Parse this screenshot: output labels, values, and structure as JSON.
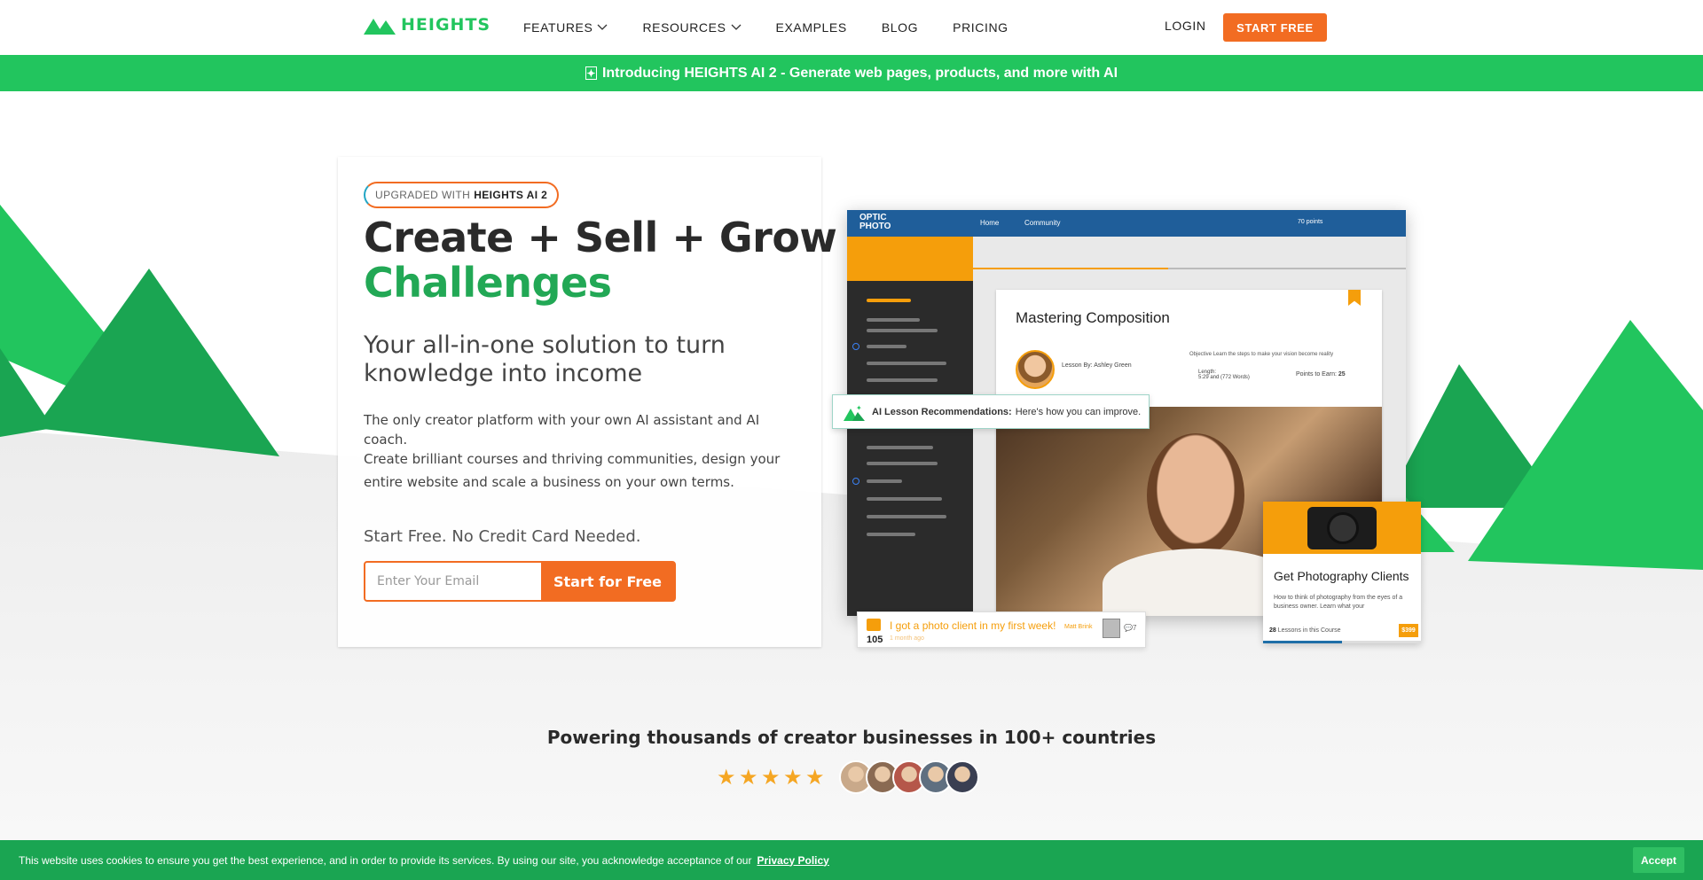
{
  "nav": {
    "logo_text": "HEIGHTS",
    "menu": [
      {
        "label": "FEATURES",
        "has_dropdown": true
      },
      {
        "label": "RESOURCES",
        "has_dropdown": true
      },
      {
        "label": "EXAMPLES",
        "has_dropdown": false
      },
      {
        "label": "BLOG",
        "has_dropdown": false
      },
      {
        "label": "PRICING",
        "has_dropdown": false
      }
    ],
    "login_label": "LOGIN",
    "start_label": "START FREE"
  },
  "announcement": {
    "icon": "sparkle-icon",
    "text": "Introducing HEIGHTS AI 2 - Generate web pages, products, and more with AI"
  },
  "hero": {
    "badge_prefix": "UPGRADED WITH",
    "badge_strong": "HEIGHTS AI 2",
    "headline_line1": "Create + Sell + Grow",
    "headline_line2": "Challenges",
    "subheadline": "Your all-in-one solution to turn knowledge into income",
    "paragraph1": "The only creator platform with your own AI assistant and AI coach.",
    "paragraph2": "Create brilliant courses and thriving communities, design your entire website and scale a business on your own terms.",
    "cta_label": "Start Free. No Credit Card Needed.",
    "email_placeholder": "Enter Your Email",
    "email_value": "",
    "cta_button": "Start for Free"
  },
  "mockup": {
    "brand_line1": "OPTIC",
    "brand_line2": "PHOTO",
    "home_link": "Home",
    "community_link": "Community",
    "points_label": "70 points",
    "lesson_title": "Mastering Composition",
    "lesson_by": "Lesson By: Ashley Green",
    "objective_label": "Objective",
    "objective_text": "Learn the steps to make your vision become reality",
    "length_label": "Length:",
    "length_value": "5:29 and (772 Words)",
    "points_to_earn_label": "Points to Earn:",
    "points_to_earn_value": "25",
    "ai_rec_strong": "AI Lesson Recommendations:",
    "ai_rec_text": "Here's how you can improve.",
    "comment_text": "I got a photo client in my first week!",
    "comment_votes": "105",
    "comment_ago": "1 month ago",
    "comment_author": "Matt Brink",
    "comment_count": "7",
    "course_title": "Get Photography Clients",
    "course_desc": "How to think of photography from the eyes of a business owner. Learn what your",
    "course_lessons_count": "28",
    "course_lessons_label": "Lessons in this Course",
    "course_price": "$399",
    "progress_fraction": 0.45,
    "course_progress_fraction": 0.5
  },
  "proof": {
    "text": "Powering thousands of creator businesses in 100+ countries",
    "rating_stars": 5,
    "avatar_colors": [
      "#c9a98a",
      "#8a6a52",
      "#b5574a",
      "#5f6f80",
      "#3a3f52"
    ]
  },
  "cookie": {
    "message": "This website uses cookies to ensure you get the best experience, and in order to provide its services. By using our site, you acknowledge acceptance of our",
    "link_label": "Privacy Policy",
    "accept_label": "Accept"
  },
  "colors": {
    "brand_green": "#22c55e",
    "brand_orange": "#f26c22",
    "cookie_green": "#1aa552",
    "mock_blue": "#1f5e9a",
    "accent_amber": "#f59e0b"
  }
}
